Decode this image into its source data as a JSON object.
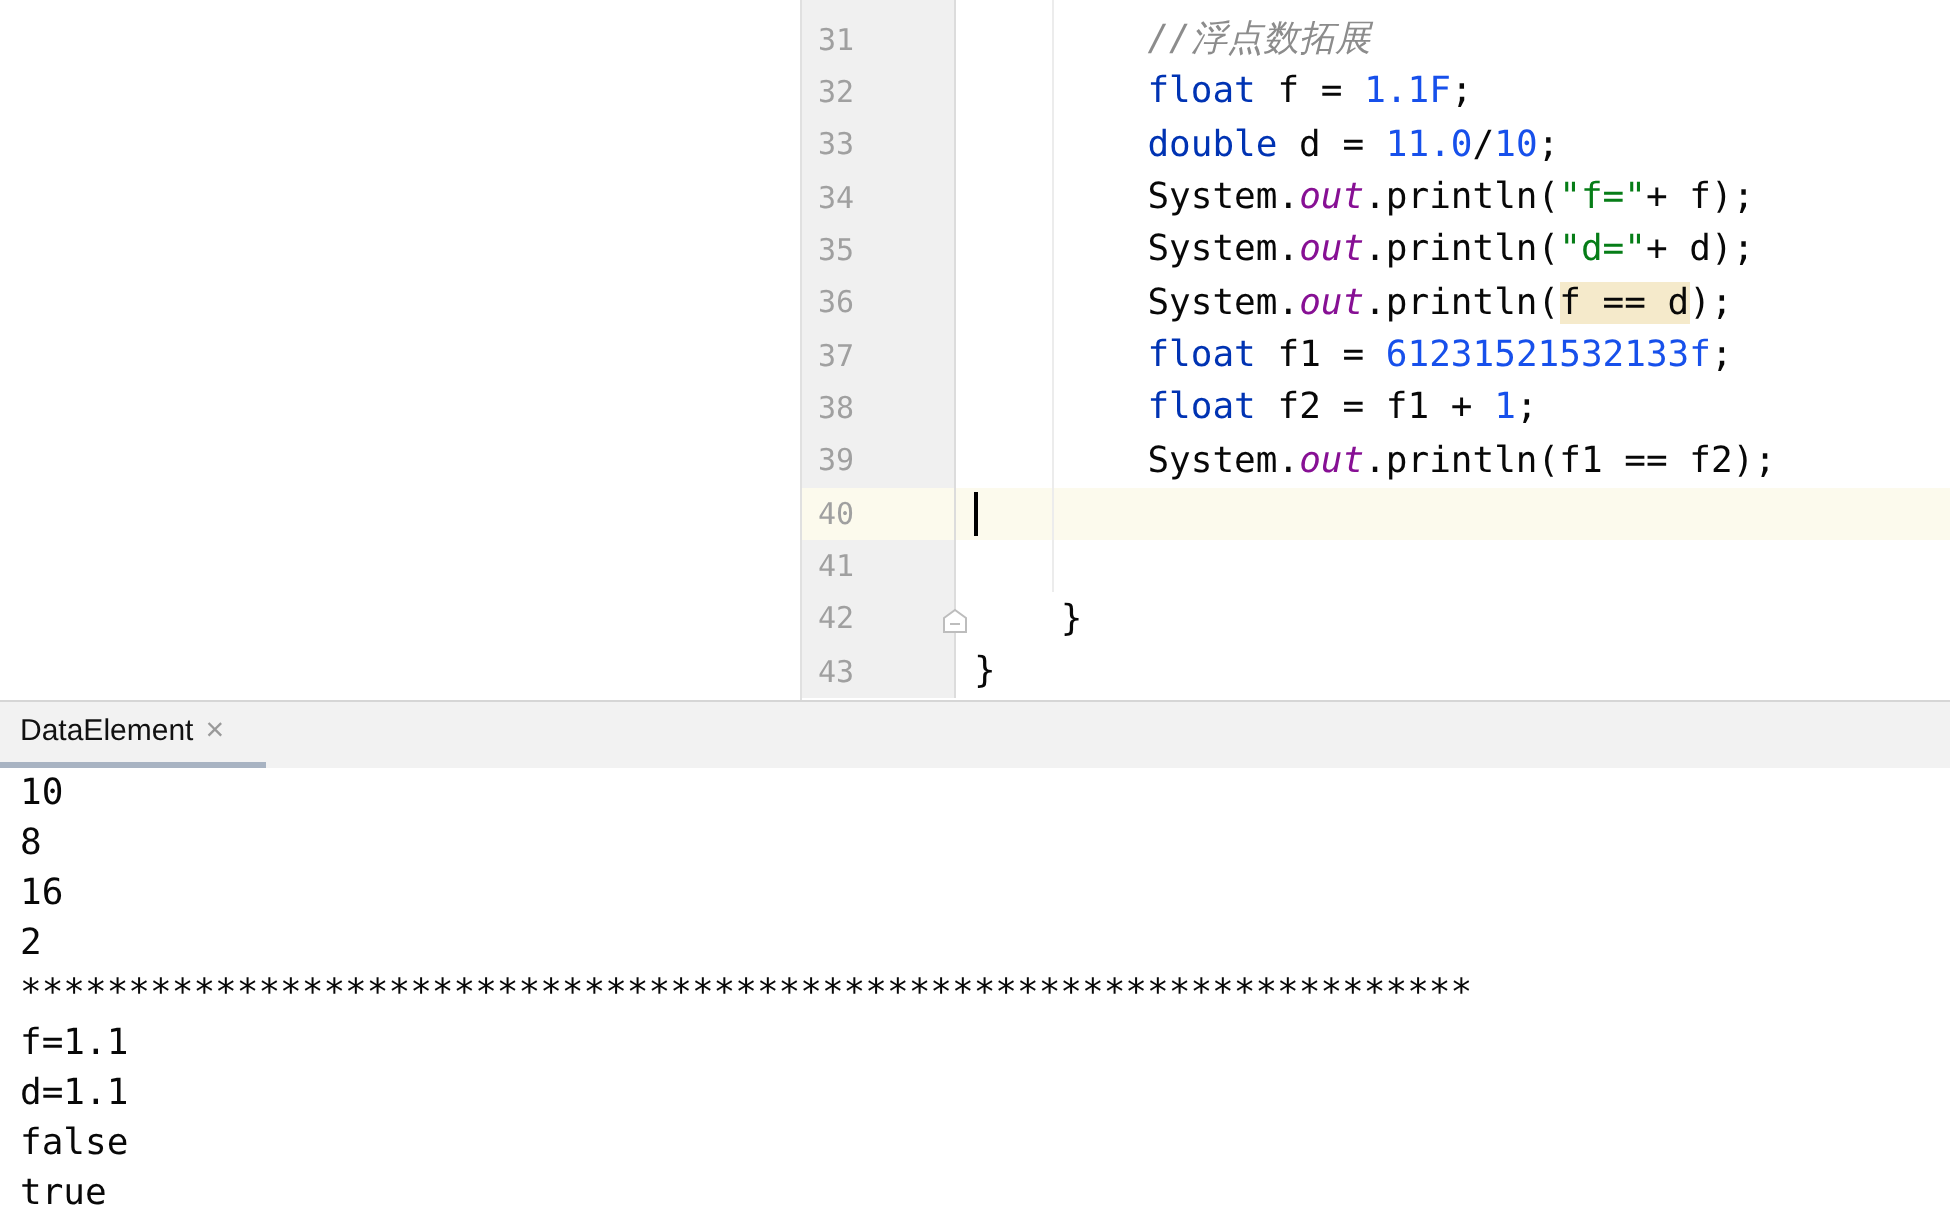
{
  "editor": {
    "lines": [
      {
        "number": "31",
        "current": false,
        "tokens": [
          {
            "kind": "comment",
            "text": "        //浮点数拓展"
          }
        ]
      },
      {
        "number": "32",
        "current": false,
        "tokens": [
          {
            "kind": "keyword",
            "text": "        float"
          },
          {
            "kind": "plain",
            "text": " f = "
          },
          {
            "kind": "number",
            "text": "1.1F"
          },
          {
            "kind": "plain",
            "text": ";"
          }
        ]
      },
      {
        "number": "33",
        "current": false,
        "tokens": [
          {
            "kind": "keyword",
            "text": "        double"
          },
          {
            "kind": "plain",
            "text": " d = "
          },
          {
            "kind": "number",
            "text": "11.0"
          },
          {
            "kind": "plain",
            "text": "/"
          },
          {
            "kind": "number",
            "text": "10"
          },
          {
            "kind": "plain",
            "text": ";"
          }
        ]
      },
      {
        "number": "34",
        "current": false,
        "tokens": [
          {
            "kind": "plain",
            "text": "        System."
          },
          {
            "kind": "field",
            "text": "out"
          },
          {
            "kind": "plain",
            "text": ".println("
          },
          {
            "kind": "string",
            "text": "\"f=\""
          },
          {
            "kind": "plain",
            "text": "+ f);"
          }
        ]
      },
      {
        "number": "35",
        "current": false,
        "tokens": [
          {
            "kind": "plain",
            "text": "        System."
          },
          {
            "kind": "field",
            "text": "out"
          },
          {
            "kind": "plain",
            "text": ".println("
          },
          {
            "kind": "string",
            "text": "\"d=\""
          },
          {
            "kind": "plain",
            "text": "+ d);"
          }
        ]
      },
      {
        "number": "36",
        "current": false,
        "tokens": [
          {
            "kind": "plain",
            "text": "        System."
          },
          {
            "kind": "field",
            "text": "out"
          },
          {
            "kind": "plain",
            "text": ".println("
          },
          {
            "kind": "highlight",
            "text": "f == d"
          },
          {
            "kind": "plain",
            "text": ");"
          }
        ]
      },
      {
        "number": "37",
        "current": false,
        "tokens": [
          {
            "kind": "keyword",
            "text": "        float"
          },
          {
            "kind": "plain",
            "text": " f1 = "
          },
          {
            "kind": "number",
            "text": "61231521532133f"
          },
          {
            "kind": "plain",
            "text": ";"
          }
        ]
      },
      {
        "number": "38",
        "current": false,
        "tokens": [
          {
            "kind": "keyword",
            "text": "        float"
          },
          {
            "kind": "plain",
            "text": " f2 = f1 + "
          },
          {
            "kind": "number",
            "text": "1"
          },
          {
            "kind": "plain",
            "text": ";"
          }
        ]
      },
      {
        "number": "39",
        "current": false,
        "tokens": [
          {
            "kind": "plain",
            "text": "        System."
          },
          {
            "kind": "field",
            "text": "out"
          },
          {
            "kind": "plain",
            "text": ".println(f1 == f2);"
          }
        ]
      },
      {
        "number": "40",
        "current": true
      },
      {
        "number": "41",
        "current": false
      },
      {
        "number": "42",
        "current": false,
        "fold": true,
        "tokens": [
          {
            "kind": "plain",
            "text": "    }"
          }
        ]
      },
      {
        "number": "43",
        "current": false,
        "tokens": [
          {
            "kind": "plain",
            "text": "}"
          }
        ]
      }
    ]
  },
  "console": {
    "tab": {
      "label": "DataElement",
      "close": "×",
      "selected": true
    },
    "output": [
      "10",
      "8",
      "16",
      "2",
      "*******************************************************************",
      "f=1.1",
      "d=1.1",
      "false",
      "true"
    ]
  }
}
